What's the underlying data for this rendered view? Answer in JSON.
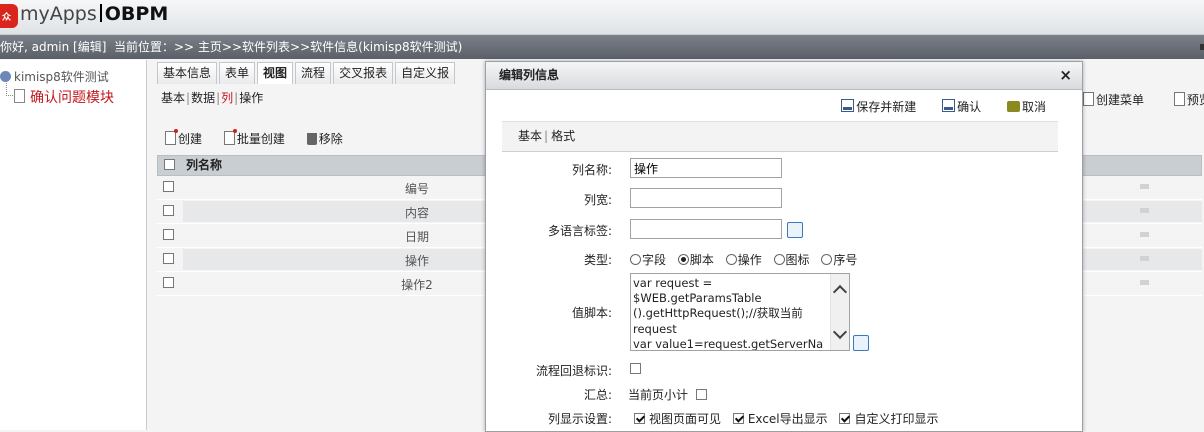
{
  "app": {
    "logo_badge": "众",
    "name": "myApps",
    "product": "OBPM"
  },
  "infobar": {
    "greeting": "你好, admin [编辑]",
    "location": "当前位置：>> 主页>>软件列表>>软件信息(kimisp8软件测试)"
  },
  "tree": {
    "root": "kimisp8软件测试",
    "child": "确认问题模块"
  },
  "tabs": [
    "基本信息",
    "表单",
    "视图",
    "流程",
    "交叉报表",
    "自定义报"
  ],
  "active_tab": "视图",
  "subtabs": {
    "items": [
      "基本",
      "数据",
      "列",
      "操作"
    ],
    "active": "列"
  },
  "list_toolbar": {
    "create": "创建",
    "batch_create": "批量创建",
    "remove": "移除"
  },
  "right_toolbar": {
    "create_menu": "创建菜单",
    "preview": "预览"
  },
  "grid": {
    "header": "列名称",
    "rows": [
      "编号",
      "内容",
      "日期",
      "操作",
      "操作2"
    ]
  },
  "dialog": {
    "title": "编辑列信息",
    "close": "×",
    "actions": {
      "save_new": "保存并新建",
      "confirm": "确认",
      "cancel": "取消"
    },
    "subtabs": [
      "基本",
      "格式"
    ],
    "labels": {
      "name": "列名称:",
      "width": "列宽:",
      "i18n": "多语言标签:",
      "type": "类型:",
      "script": "值脚本:",
      "flow_back": "流程回退标识:",
      "summary": "汇总:",
      "display": "列显示设置:"
    },
    "values": {
      "name": "操作",
      "width": "",
      "i18n": "",
      "script": "var request =\n$WEB.getParamsTable\n().getHttpRequest();//获取当前\nrequest\nvar value1=request.getServerName"
    },
    "type_options": [
      "字段",
      "脚本",
      "操作",
      "图标",
      "序号"
    ],
    "type_selected": "脚本",
    "summary_option": "当前页小计",
    "display_options": [
      "视图页面可见",
      "Excel导出显示",
      "自定义打印显示"
    ]
  }
}
